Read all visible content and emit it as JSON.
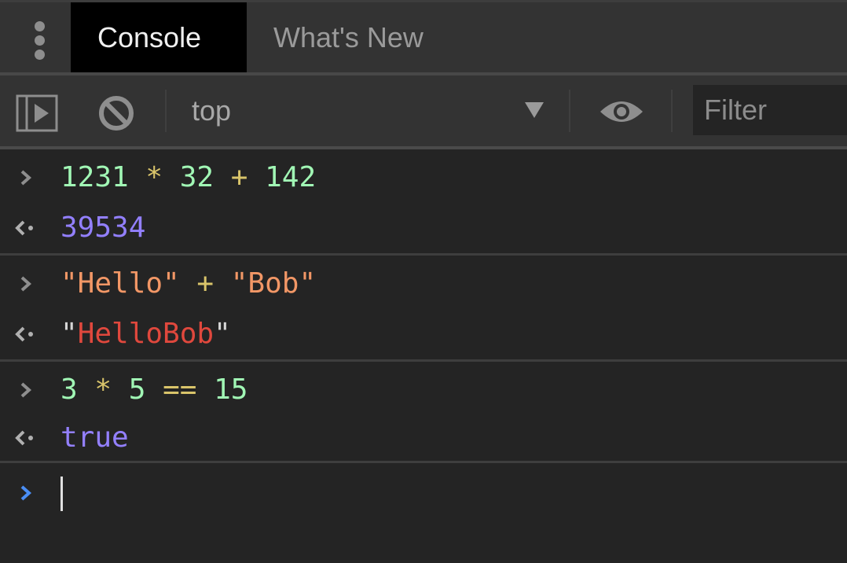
{
  "tabs": [
    {
      "label": "Console",
      "active": true
    },
    {
      "label": "What's New",
      "active": false
    }
  ],
  "toolbar": {
    "context": "top",
    "filter_placeholder": "Filter"
  },
  "icons": {
    "menu": "kebab-menu-icon",
    "sidebar": "sidebar-toggle-icon",
    "clear": "clear-console-icon",
    "dropdown": "triangle-down-icon",
    "eye": "eye-icon",
    "input_prompt": "chevron-right-icon",
    "output_prompt": "return-arrow-icon"
  },
  "colors": {
    "number": "#a1f7b5",
    "operator": "#d9c46a",
    "result": "#9380ff",
    "string": "#f29766",
    "result_string": "#e0483d",
    "prompt_active": "#4a8ef5"
  },
  "entries": [
    {
      "input": {
        "a": "1231",
        "op1": " * ",
        "b": "32",
        "op2": " + ",
        "c": "142"
      },
      "output": "39534"
    },
    {
      "input": {
        "a": "\"Hello\"",
        "op1": " + ",
        "b": "\"Bob\""
      },
      "output": {
        "q1": "\"",
        "value": "HelloBob",
        "q2": "\""
      }
    },
    {
      "input": {
        "a": "3",
        "op1": " * ",
        "b": "5",
        "op2": " == ",
        "c": "15"
      },
      "output": "true"
    }
  ]
}
